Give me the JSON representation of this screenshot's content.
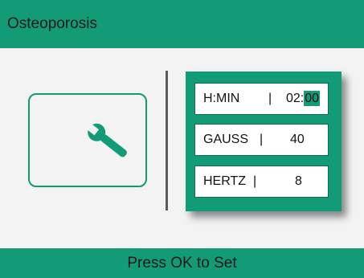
{
  "header": {
    "title": "Osteoporosis"
  },
  "footer": {
    "hint": "Press OK to Set"
  },
  "tool": {
    "icon": "wrench-icon"
  },
  "settings": {
    "hmin": {
      "label": "H:MIN",
      "sep": "|",
      "hours": "02",
      "colon": ":",
      "minutes": "00"
    },
    "gauss": {
      "label": "GAUSS",
      "sep": "|",
      "value": "40"
    },
    "hertz": {
      "label": "HERTZ",
      "sep": "|",
      "value": "8"
    }
  },
  "colors": {
    "accent": "#139b77",
    "background": "#f3f3f3",
    "divider": "#5a5a5a"
  }
}
